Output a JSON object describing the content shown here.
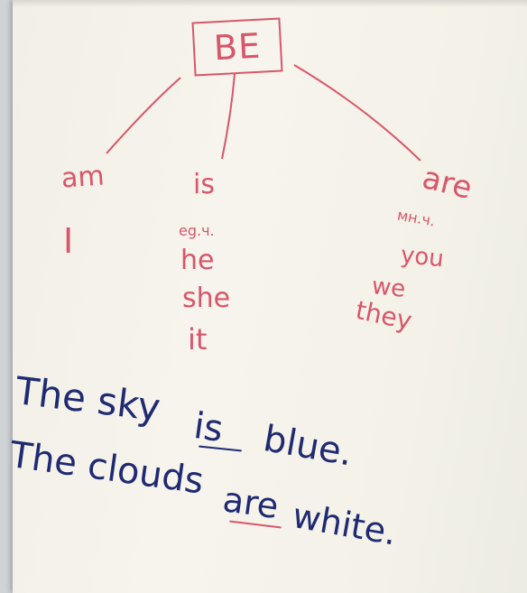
{
  "header": {
    "verb": "BE"
  },
  "columns": {
    "am": {
      "title": "am",
      "pronouns": [
        "I"
      ]
    },
    "is": {
      "title": "is",
      "note": "eg.ч.",
      "pronouns": [
        "he",
        "she",
        "it"
      ]
    },
    "are": {
      "title": "are",
      "note": "мн.ч.",
      "pronouns": [
        "you",
        "we",
        "they"
      ]
    }
  },
  "sentences": [
    {
      "subject": "The sky",
      "verb": "is",
      "complement": "blue."
    },
    {
      "subject": "The clouds",
      "verb": "are",
      "complement": "white."
    }
  ],
  "colors": {
    "marker_red": "#d8566a",
    "marker_blue": "#1f2a72",
    "paper": "#f4f2ea"
  }
}
